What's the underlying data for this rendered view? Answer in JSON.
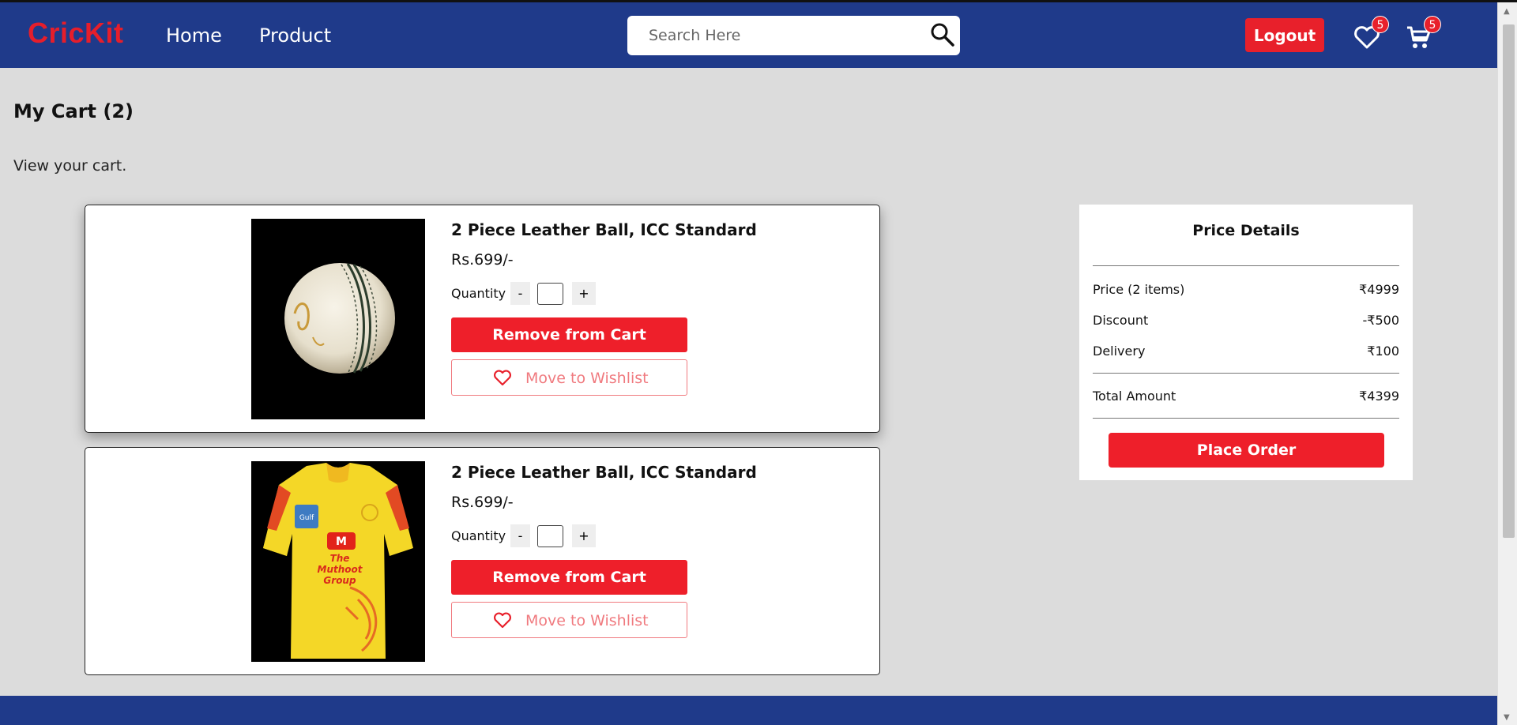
{
  "header": {
    "logo": "CricKit",
    "nav": {
      "home": "Home",
      "product": "Product"
    },
    "search_placeholder": "Search Here",
    "logout_label": "Logout",
    "wishlist_count": "5",
    "cart_count": "5"
  },
  "page": {
    "title": "My Cart (2)",
    "subtitle": "View your cart."
  },
  "cart_items": [
    {
      "name": "2 Piece Leather Ball, ICC Standard",
      "price": "Rs.699/-",
      "quantity_label": "Quantity",
      "minus": "-",
      "plus": "+",
      "remove_label": "Remove from Cart",
      "wishlist_label": "Move to Wishlist"
    },
    {
      "name": "2 Piece Leather Ball, ICC Standard",
      "price": "Rs.699/-",
      "quantity_label": "Quantity",
      "minus": "-",
      "plus": "+",
      "remove_label": "Remove from Cart",
      "wishlist_label": "Move to Wishlist"
    }
  ],
  "price_details": {
    "title": "Price Details",
    "rows": [
      {
        "label": "Price (2 items)",
        "value": "₹4999"
      },
      {
        "label": "Discount",
        "value": "-₹500"
      },
      {
        "label": "Delivery",
        "value": "₹100"
      }
    ],
    "total_label": "Total Amount",
    "total_value": "₹4399",
    "place_order_label": "Place Order"
  },
  "jersey_text": {
    "sponsor_line1": "The",
    "sponsor_line2": "Muthoot",
    "sponsor_line3": "Group",
    "badge": "Gulf"
  },
  "colors": {
    "navbar": "#1f3a8a",
    "accent_red": "#ee1f2a",
    "background": "#dcdcdc"
  }
}
